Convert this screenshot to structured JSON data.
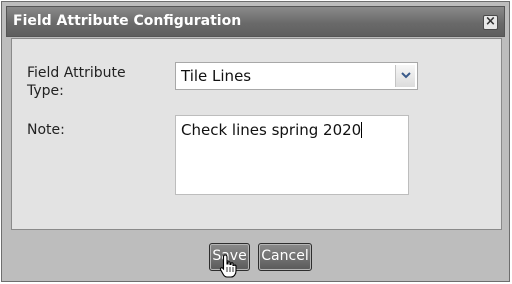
{
  "dialog": {
    "title": "Field Attribute Configuration",
    "close_glyph": "×",
    "field_type_label": "Field Attribute\nType:",
    "field_type_value": "Tile Lines",
    "note_label": "Note:",
    "note_value": "Check lines spring 2020"
  },
  "buttons": {
    "save": "Save",
    "cancel": "Cancel"
  },
  "icons": {
    "dropdown": "chevron-down-icon",
    "close": "close-icon",
    "cursor": "hand-pointer-icon"
  }
}
